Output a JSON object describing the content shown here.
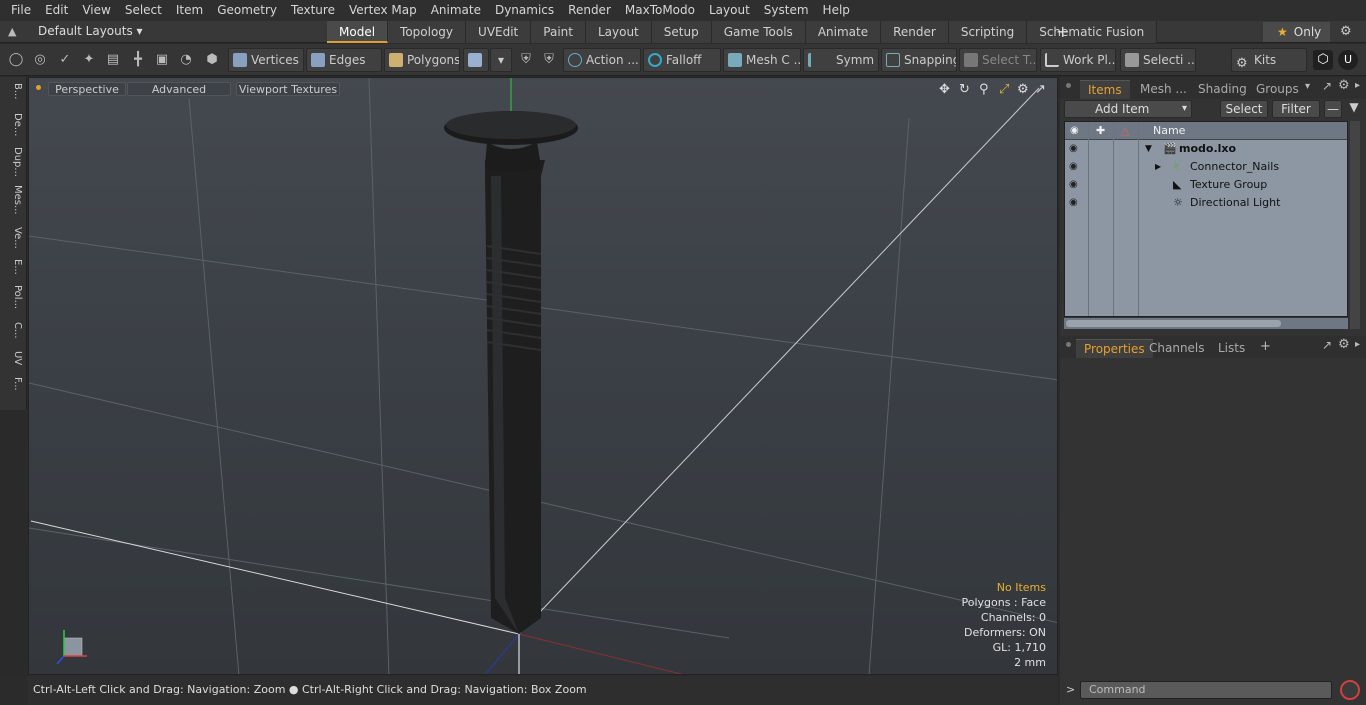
{
  "menu": [
    "File",
    "Edit",
    "View",
    "Select",
    "Item",
    "Geometry",
    "Texture",
    "Vertex Map",
    "Animate",
    "Dynamics",
    "Render",
    "MaxToModo",
    "Layout",
    "System",
    "Help"
  ],
  "layout_selector": "Default Layouts",
  "mode_tabs": [
    "Model",
    "Topology",
    "UVEdit",
    "Paint",
    "Layout",
    "Setup",
    "Game Tools",
    "Animate",
    "Render",
    "Scripting",
    "Schematic Fusion"
  ],
  "active_mode_tab": "Model",
  "only_label": "Only",
  "toolbar": {
    "vertices": "Vertices",
    "edges": "Edges",
    "polygons": "Polygons",
    "action": "Action",
    "falloff": "Falloff",
    "mesh_c": "Mesh C ...",
    "symm": "Symm ...",
    "snapping": "Snapping",
    "select_t": "Select T...",
    "work_pl": "Work Pl...",
    "selecti": "Selecti ...",
    "kits": "Kits"
  },
  "left_tabs": [
    "B...",
    "De...",
    "Dup...",
    "Mes...",
    "Ve...",
    "E...",
    "Pol...",
    "C...",
    "UV",
    "F..."
  ],
  "viewport": {
    "perspective": "Perspective",
    "advanced": "Advanced",
    "viewport_textures": "Viewport Textures",
    "stats": {
      "items": "No Items",
      "polygons": "Polygons : Face",
      "channels": "Channels: 0",
      "deformers": "Deformers: ON",
      "gl": "GL: 1,710",
      "scale": "2 mm"
    }
  },
  "status_text": "Ctrl-Alt-Left Click and Drag: Navigation: Zoom ● Ctrl-Alt-Right Click and Drag: Navigation: Box Zoom",
  "items_panel": {
    "tabs": [
      "Items",
      "Mesh ...",
      "Shading",
      "Groups"
    ],
    "active_tab": "Items",
    "add_item": "Add Item",
    "select": "Select",
    "filter": "Filter",
    "name_header": "Name",
    "tree": [
      {
        "label": "modo.lxo",
        "level": 0
      },
      {
        "label": "Connector_Nails",
        "level": 1
      },
      {
        "label": "Texture Group",
        "level": 1
      },
      {
        "label": "Directional Light",
        "level": 1
      }
    ]
  },
  "properties_panel": {
    "tabs": [
      "Properties",
      "Channels",
      "Lists"
    ],
    "active_tab": "Properties"
  },
  "command_placeholder": "Command"
}
